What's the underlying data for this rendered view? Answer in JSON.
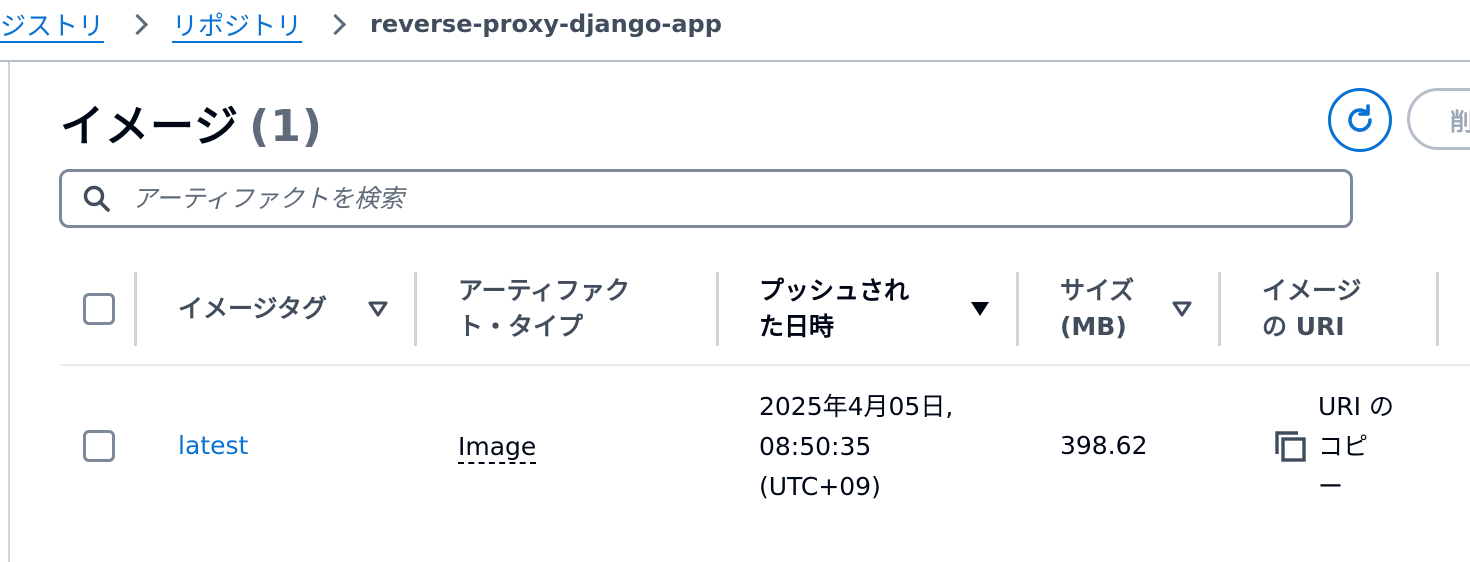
{
  "breadcrumb": {
    "items": [
      {
        "label": "ジストリ"
      },
      {
        "label": "リポジトリ"
      }
    ],
    "current": "reverse-proxy-django-app"
  },
  "header": {
    "title": "イメージ",
    "count": "(1)",
    "refresh_icon": "refresh-icon",
    "delete_label": "削除"
  },
  "search": {
    "placeholder": "アーティファクトを検索",
    "value": ""
  },
  "table": {
    "columns": [
      {
        "line1": "イメージタグ",
        "line2": "",
        "sort": "sortable"
      },
      {
        "line1": "アーティファク",
        "line2": "ト・タイプ",
        "sort": "none"
      },
      {
        "line1": "プッシュされ",
        "line2": "た日時",
        "sort": "descending"
      },
      {
        "line1": "サイズ",
        "line2": "(MB)",
        "sort": "sortable"
      },
      {
        "line1": "イメージ",
        "line2": "の URI",
        "sort": "none"
      }
    ],
    "rows": [
      {
        "tag": "latest",
        "artifact_type": "Image",
        "pushed_line1": "2025年4月05日,",
        "pushed_line2": "08:50:35",
        "pushed_line3": "(UTC+09)",
        "size": "398.62",
        "uri_copy_line1": "URI の",
        "uri_copy_line2": "コピ",
        "uri_copy_line3": "ー",
        "copy_icon": "copy-icon"
      }
    ]
  },
  "colors": {
    "link": "#0972d3",
    "header_text": "#414d5c",
    "border": "#7d8998"
  }
}
